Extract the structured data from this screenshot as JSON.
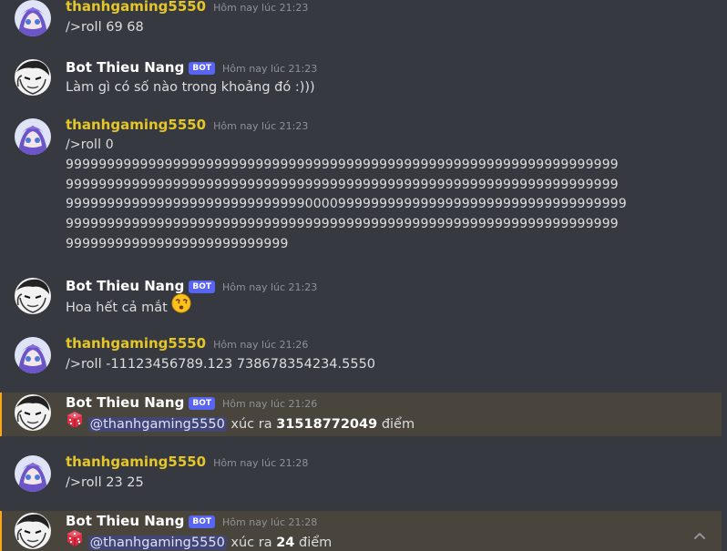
{
  "timestamp_prefix": "Hôm nay lúc",
  "colors": {
    "background": "#36393f",
    "user_name": "#e5c62a",
    "bot_badge": "#5865f2",
    "highlight": "#49443c",
    "highlight_bar": "#faa81a",
    "mention_bg": "#414675"
  },
  "messages": [
    {
      "author": "thanhgaming5550",
      "is_bot": false,
      "time": "Hôm nay lúc 21:23",
      "text": "/>roll 69 68"
    },
    {
      "author": "Bot Thieu Nang",
      "is_bot": true,
      "badge": "BOT",
      "time": "Hôm nay lúc 21:23",
      "text": "Làm gì có số nào trong khoảng đó :)))"
    },
    {
      "author": "thanhgaming5550",
      "is_bot": false,
      "time": "Hôm nay lúc 21:23",
      "lines": [
        "/>roll 0",
        "9999999999999999999999999999999999999999999999999999999999999999999",
        "9999999999999999999999999999999999999999999999999999999999999999999",
        "99999999999999999999999999999000099999999999999999999999999999999999",
        "9999999999999999999999999999999999999999999999999999999999999999999",
        "999999999999999999999999999"
      ]
    },
    {
      "author": "Bot Thieu Nang",
      "is_bot": true,
      "badge": "BOT",
      "time": "Hôm nay lúc 21:23",
      "text": "Hoa hết cả mắt",
      "emoji": "dizzy-face-emoji"
    },
    {
      "author": "thanhgaming5550",
      "is_bot": false,
      "time": "Hôm nay lúc 21:26",
      "text": "/>roll -11123456789.123 738678354234.5550"
    },
    {
      "author": "Bot Thieu Nang",
      "is_bot": true,
      "badge": "BOT",
      "time": "Hôm nay lúc 21:26",
      "mention": "@thanhgaming5550",
      "pre": "xúc ra",
      "value": "31518772049",
      "post": "điểm",
      "emoji": "game-die-emoji"
    },
    {
      "author": "thanhgaming5550",
      "is_bot": false,
      "time": "Hôm nay lúc 21:28",
      "text": "/>roll 23 25"
    },
    {
      "author": "Bot Thieu Nang",
      "is_bot": true,
      "badge": "BOT",
      "time": "Hôm nay lúc 21:28",
      "mention": "@thanhgaming5550",
      "pre": "xúc ra",
      "value": "24",
      "post": "điểm",
      "emoji": "game-die-emoji"
    }
  ],
  "scroll_button_icon": "chevron-up-icon"
}
